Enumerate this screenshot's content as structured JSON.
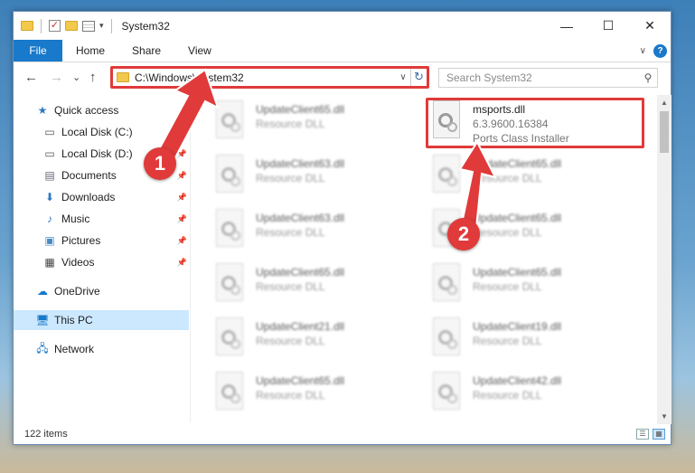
{
  "window": {
    "title": "System32",
    "controls": {
      "minimize": "—",
      "maximize": "☐",
      "close": "✕"
    }
  },
  "ribbon": {
    "tabs": [
      "File",
      "Home",
      "Share",
      "View"
    ],
    "help": "?"
  },
  "address": {
    "path": "C:\\Windows\\System32",
    "search_placeholder": "Search System32"
  },
  "nav": {
    "back": "←",
    "forward": "→",
    "recent": "⌄",
    "up": "↑"
  },
  "sidebar": {
    "items": [
      {
        "label": "Quick access",
        "icon": "star-icon"
      },
      {
        "label": "Local Disk (C:)",
        "icon": "drive-icon",
        "pinned": true
      },
      {
        "label": "Local Disk (D:)",
        "icon": "drive-icon",
        "pinned": true
      },
      {
        "label": "Documents",
        "icon": "documents-icon",
        "pinned": true
      },
      {
        "label": "Downloads",
        "icon": "download-icon",
        "pinned": true
      },
      {
        "label": "Music",
        "icon": "music-icon",
        "pinned": true
      },
      {
        "label": "Pictures",
        "icon": "pictures-icon",
        "pinned": true
      },
      {
        "label": "Videos",
        "icon": "videos-icon",
        "pinned": true
      },
      {
        "label": "OneDrive",
        "icon": "cloud-icon"
      },
      {
        "label": "This PC",
        "icon": "computer-icon",
        "selected": true
      },
      {
        "label": "Network",
        "icon": "network-icon"
      }
    ]
  },
  "files": [
    {
      "name": "UpdateClient65.dll",
      "desc": "Resource DLL"
    },
    {
      "name": "msports.dll",
      "version": "6.3.9600.16384",
      "desc": "Ports Class Installer"
    },
    {
      "name": "UpdateClient63.dll",
      "desc": "Resource DLL"
    },
    {
      "name": "UpdateClient65.dll",
      "desc": "Resource DLL"
    },
    {
      "name": "UpdateClient63.dll",
      "desc": "Resource DLL"
    },
    {
      "name": "UpdateClient65.dll",
      "desc": "Resource DLL"
    },
    {
      "name": "UpdateClient65.dll",
      "desc": "Resource DLL"
    },
    {
      "name": "UpdateClient65.dll",
      "desc": "Resource DLL"
    },
    {
      "name": "UpdateClient21.dll",
      "desc": "Resource DLL"
    },
    {
      "name": "UpdateClient19.dll",
      "desc": "Resource DLL"
    },
    {
      "name": "UpdateClient65.dll",
      "desc": "Resource DLL"
    },
    {
      "name": "UpdateClient42.dll",
      "desc": "Resource DLL"
    }
  ],
  "status": {
    "items": "122 items"
  },
  "annotations": {
    "step1": "1",
    "step2": "2",
    "color": "#e03a3a"
  }
}
